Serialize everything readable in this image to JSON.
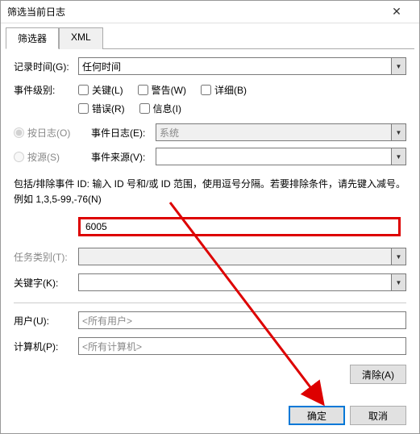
{
  "title": "筛选当前日志",
  "tabs": {
    "filter": "筛选器",
    "xml": "XML"
  },
  "labels": {
    "log_time": "记录时间(G):",
    "event_level": "事件级别:",
    "by_log": "按日志(O)",
    "by_source": "按源(S)",
    "event_log": "事件日志(E):",
    "event_source": "事件来源(V):",
    "task_category": "任务类别(T):",
    "keyword": "关键字(K):",
    "user": "用户(U):",
    "computer": "计算机(P):"
  },
  "values": {
    "log_time": "任何时间",
    "event_log": "系统",
    "event_id": "6005",
    "user": "<所有用户>",
    "computer": "<所有计算机>"
  },
  "checks": {
    "critical": "关键(L)",
    "warning": "警告(W)",
    "verbose": "详细(B)",
    "error": "错误(R)",
    "info": "信息(I)"
  },
  "help_text": "包括/排除事件 ID: 输入 ID 号和/或 ID 范围，使用逗号分隔。若要排除条件，请先键入减号。例如 1,3,5-99,-76(N)",
  "buttons": {
    "clear": "清除(A)",
    "ok": "确定",
    "cancel": "取消"
  }
}
